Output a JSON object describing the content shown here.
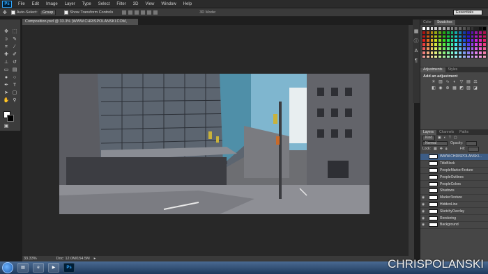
{
  "menu": [
    "File",
    "Edit",
    "Image",
    "Layer",
    "Type",
    "Select",
    "Filter",
    "3D",
    "View",
    "Window",
    "Help"
  ],
  "app_logo": "Ps",
  "options": {
    "auto_select_label": "Auto-Select:",
    "auto_select_value": "Group",
    "transform_label": "Show Transform Controls",
    "mode_3d_label": "3D Mode:",
    "workspace": "Essentials"
  },
  "document_tab": "Composition.psd @ 33.3% (WWW.CHRISPOLANSKI.COM, RGB/8) *",
  "status": {
    "zoom": "33.33%",
    "doc_size": "Doc: 12.0M/154.5M"
  },
  "panels": {
    "color_tabs": [
      "Color",
      "Swatches"
    ],
    "adjust_tabs": [
      "Adjustments",
      "Styles"
    ],
    "adjust_title": "Add an adjustment",
    "layers_tabs": [
      "Layers",
      "Channels",
      "Paths"
    ],
    "kind_label": "Kind",
    "blend_mode": "Normal",
    "opacity_label": "Opacity:",
    "lock_label": "Lock:",
    "fill_label": "Fill:"
  },
  "layers": [
    {
      "name": "WWW.CHRISPOLANSKI...",
      "visible": false,
      "selected": true
    },
    {
      "name": "TitleBlock",
      "visible": false,
      "selected": false
    },
    {
      "name": "PeopleMarkerTexture",
      "visible": false,
      "selected": false
    },
    {
      "name": "PeopleOutlines",
      "visible": false,
      "selected": false
    },
    {
      "name": "PeopleColors",
      "visible": false,
      "selected": false
    },
    {
      "name": "Shadows",
      "visible": false,
      "selected": false
    },
    {
      "name": "MarkerTexture",
      "visible": true,
      "selected": false
    },
    {
      "name": "HiddenLine",
      "visible": true,
      "selected": false
    },
    {
      "name": "SketchyOverlay",
      "visible": true,
      "selected": false
    },
    {
      "name": "Rendering",
      "visible": true,
      "selected": false
    },
    {
      "name": "Background",
      "visible": true,
      "selected": false
    }
  ],
  "watermark": "CHRISPOLANSKI",
  "colors": {
    "menubar": "#2b2b2b",
    "canvas_bg": "#282828",
    "selected_layer": "#3d5d86",
    "ps_blue": "#31a8ff"
  }
}
